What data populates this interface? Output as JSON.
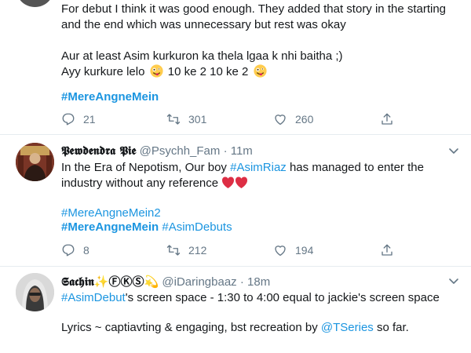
{
  "colors": {
    "link": "#1b95e0",
    "muted": "#657786",
    "text": "#14171a",
    "divider": "#e6ecf0",
    "heart": "#e0245e"
  },
  "tweet1": {
    "line1": "For debut I think it was good enough. They added that story in the starting",
    "line2": "and the end which was unnecessary but rest was okay",
    "line3": "Aur at least Asim kurkuron ka thela lgaa k nhi baitha ;)",
    "line4_a": "Ayy kurkure lelo",
    "line4_b": "10 ke 2 10 ke 2",
    "hashtag": "#MereAngneMein",
    "replies": "21",
    "retweets": "301",
    "likes": "260"
  },
  "tweet2": {
    "name": "𝕻𝖊𝖜𝖉𝖊𝖓𝖉𝖗𝖆 𝕻𝖎𝖊",
    "handle": "@Psychh_Fam",
    "time": "· 11m",
    "line1_a": "In the Era of Nepotism, Our boy",
    "line1_tag": "#AsimRiaz",
    "line1_b": "has managed to enter the",
    "line2": "industry without any reference",
    "tag1": "#MereAngneMein2",
    "tag2": "#MereAngneMein",
    "tag3": "#AsimDebuts",
    "replies": "8",
    "retweets": "212",
    "likes": "194"
  },
  "tweet3": {
    "name": "𝕾𝖆𝖈𝖍𝖎𝖓✨ⒻⓀⓈ💫",
    "handle": "@iDaringbaaz",
    "time": "· 18m",
    "line1_tag": "#AsimDebut",
    "line1_b": "'s screen space - 1:30 to 4:00 equal to jackie's screen space",
    "line2_a": "Lyrics ~ captiavting & engaging, bst recreation by",
    "line2_tag": "@TSeries",
    "line2_b": "so far."
  },
  "icons": {
    "reply": "reply-icon",
    "retweet": "retweet-icon",
    "like": "like-icon",
    "share": "share-icon",
    "caret": "chevron-down-icon",
    "emoji": "crazy-face-emoji",
    "heart": "red-heart-emoji"
  }
}
